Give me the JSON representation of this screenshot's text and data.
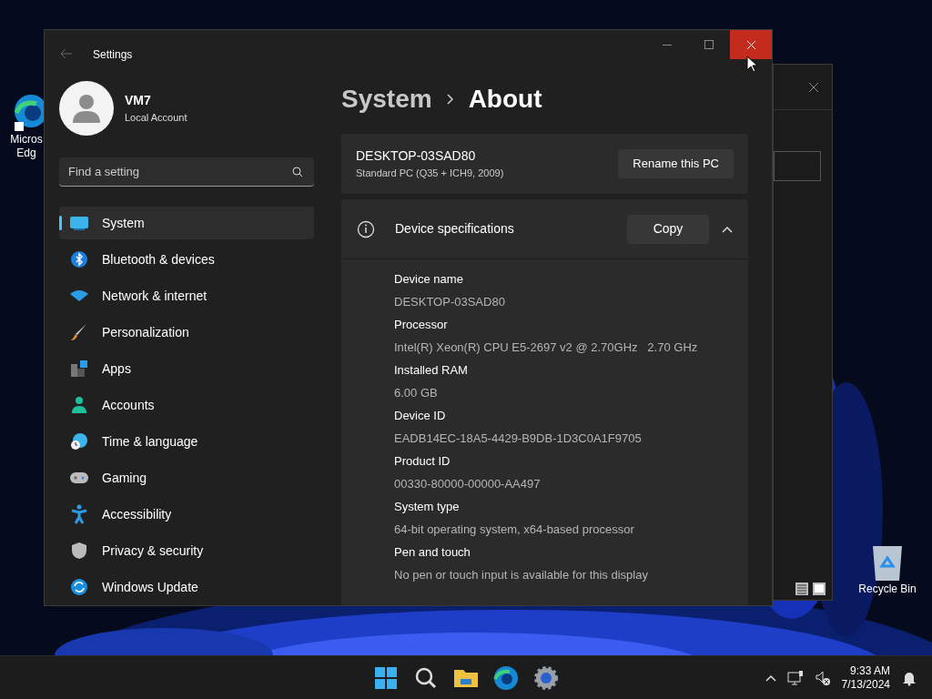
{
  "desktop_icons": [
    {
      "kind": "edge",
      "lines": [
        "Micros",
        "Edg"
      ]
    },
    {
      "kind": "recycle",
      "lines": [
        "Recycle Bin"
      ]
    }
  ],
  "window": {
    "title": "Settings",
    "account": {
      "name": "VM7",
      "type": "Local Account"
    },
    "search": {
      "placeholder": "Find a setting"
    },
    "nav": [
      {
        "label": "System",
        "selected": true
      },
      {
        "label": "Bluetooth & devices",
        "selected": false
      },
      {
        "label": "Network & internet",
        "selected": false
      },
      {
        "label": "Personalization",
        "selected": false
      },
      {
        "label": "Apps",
        "selected": false
      },
      {
        "label": "Accounts",
        "selected": false
      },
      {
        "label": "Time & language",
        "selected": false
      },
      {
        "label": "Gaming",
        "selected": false
      },
      {
        "label": "Accessibility",
        "selected": false
      },
      {
        "label": "Privacy & security",
        "selected": false
      },
      {
        "label": "Windows Update",
        "selected": false
      }
    ],
    "breadcrumb": [
      "System",
      "About"
    ],
    "pc": {
      "name": "DESKTOP-03SAD80",
      "model": "Standard PC (Q35 + ICH9, 2009)",
      "button": "Rename this PC"
    },
    "specs": {
      "title": "Device specifications",
      "button": "Copy",
      "expanded": true,
      "items": [
        {
          "label": "Device name",
          "value": "DESKTOP-03SAD80"
        },
        {
          "label": "Processor",
          "value": "Intel(R) Xeon(R) CPU E5-2697 v2 @ 2.70GHz   2.70 GHz"
        },
        {
          "label": "Installed RAM",
          "value": "6.00 GB"
        },
        {
          "label": "Device ID",
          "value": "EADB14EC-18A5-4429-B9DB-1D3C0A1F9705"
        },
        {
          "label": "Product ID",
          "value": "00330-80000-00000-AA497"
        },
        {
          "label": "System type",
          "value": "64-bit operating system, x64-based processor"
        },
        {
          "label": "Pen and touch",
          "value": "No pen or touch input is available for this display"
        }
      ]
    }
  },
  "taskbar": {
    "time": "9:33 AM",
    "date": "7/13/2024"
  }
}
